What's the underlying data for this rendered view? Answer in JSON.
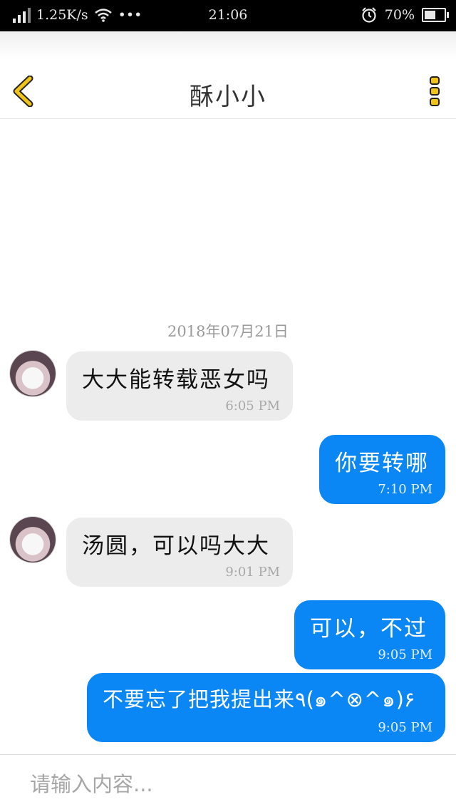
{
  "status_bar": {
    "speed": "1.25K/s",
    "dots": "•••",
    "time": "21:06",
    "battery_text": "70%",
    "battery_level": 0.7
  },
  "header": {
    "title": "酥小小",
    "accent_color": "#f0c419"
  },
  "chat": {
    "date": "2018年07月21日",
    "messages": [
      {
        "side": "in",
        "text": "大大能转载恶女吗",
        "time": "6:05 PM"
      },
      {
        "side": "out",
        "text": "你要转哪",
        "time": "7:10 PM"
      },
      {
        "side": "in",
        "text": "汤圆，可以吗大大",
        "time": "9:01 PM"
      },
      {
        "side": "out",
        "text": "可以，不过",
        "time": "9:05 PM"
      },
      {
        "side": "out",
        "text": "不要忘了把我提出来٩(๑^⊗^๑)۶",
        "time": "9:05 PM"
      }
    ],
    "outgoing_color": "#0a86f5",
    "incoming_color": "#ececec"
  },
  "input": {
    "placeholder": "请输入内容...",
    "value": ""
  }
}
